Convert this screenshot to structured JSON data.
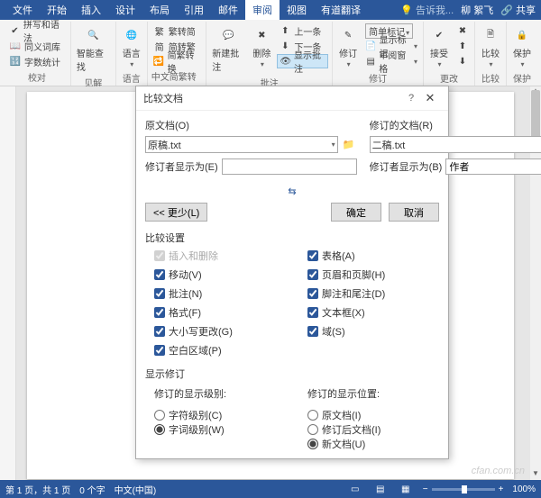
{
  "titlebar": {
    "tabs": [
      "文件",
      "开始",
      "插入",
      "设计",
      "布局",
      "引用",
      "邮件",
      "审阅",
      "视图",
      "有道翻译"
    ],
    "active_index": 7,
    "tell_me": "告诉我...",
    "user": "柳 絮飞",
    "share": "共享"
  },
  "ribbon": {
    "proofing": {
      "spelling": "拼写和语法",
      "thesaurus": "同义词库",
      "wordcount": "字数统计",
      "label": "校对"
    },
    "insights": {
      "lookup": "智能查找",
      "label": "见解"
    },
    "language": {
      "lang": "语言",
      "label": "语言"
    },
    "chinese": {
      "sc2tc": "繁转简",
      "tc2sc": "简转繁",
      "conv": "简繁转换",
      "label": "中文简繁转换"
    },
    "comments": {
      "new": "新建批注",
      "delete": "删除",
      "prev": "上一条",
      "next": "下一条",
      "show": "显示批注",
      "label": "批注"
    },
    "tracking": {
      "track": "修订",
      "markup_dd": "简单标记",
      "show_markup": "显示标记",
      "pane": "审阅窗格",
      "label": "修订"
    },
    "changes": {
      "accept": "接受",
      "reject_ico": "✖",
      "prev_ico": "⬆",
      "next_ico": "⬇",
      "label": "更改"
    },
    "compare": {
      "compare": "比较",
      "label": "比较"
    },
    "protect": {
      "protect": "保护",
      "label": "保护"
    }
  },
  "dialog": {
    "title": "比较文档",
    "orig": {
      "header": "原文档(O)",
      "value": "原稿.txt",
      "reviser_label": "修订者显示为(E)",
      "reviser_value": ""
    },
    "rev": {
      "header": "修订的文档(R)",
      "value": "二稿.txt",
      "reviser_label": "修订者显示为(B)",
      "reviser_value": "作者"
    },
    "less": "<< 更少(L)",
    "ok": "确定",
    "cancel": "取消",
    "settings_header": "比较设置",
    "left_checks": [
      {
        "label": "插入和删除",
        "checked": true,
        "disabled": true
      },
      {
        "label": "移动(V)",
        "checked": true
      },
      {
        "label": "批注(N)",
        "checked": true
      },
      {
        "label": "格式(F)",
        "checked": true
      },
      {
        "label": "大小写更改(G)",
        "checked": true
      },
      {
        "label": "空白区域(P)",
        "checked": true
      }
    ],
    "right_checks": [
      {
        "label": "表格(A)",
        "checked": true
      },
      {
        "label": "页眉和页脚(H)",
        "checked": true
      },
      {
        "label": "脚注和尾注(D)",
        "checked": true
      },
      {
        "label": "文本框(X)",
        "checked": true
      },
      {
        "label": "域(S)",
        "checked": true
      }
    ],
    "show_header": "显示修订",
    "level_header": "修订的显示级别:",
    "levels": [
      {
        "label": "字符级别(C)",
        "checked": false
      },
      {
        "label": "字词级别(W)",
        "checked": true
      }
    ],
    "position_header": "修订的显示位置:",
    "positions": [
      {
        "label": "原文档(I)",
        "checked": false
      },
      {
        "label": "修订后文档(I)",
        "checked": false
      },
      {
        "label": "新文档(U)",
        "checked": true
      }
    ]
  },
  "status": {
    "page": "第 1 页，共 1 页",
    "words": "0 个字",
    "lang": "中文(中国)",
    "zoom": "100%"
  },
  "watermark": "cfan.com.cn"
}
